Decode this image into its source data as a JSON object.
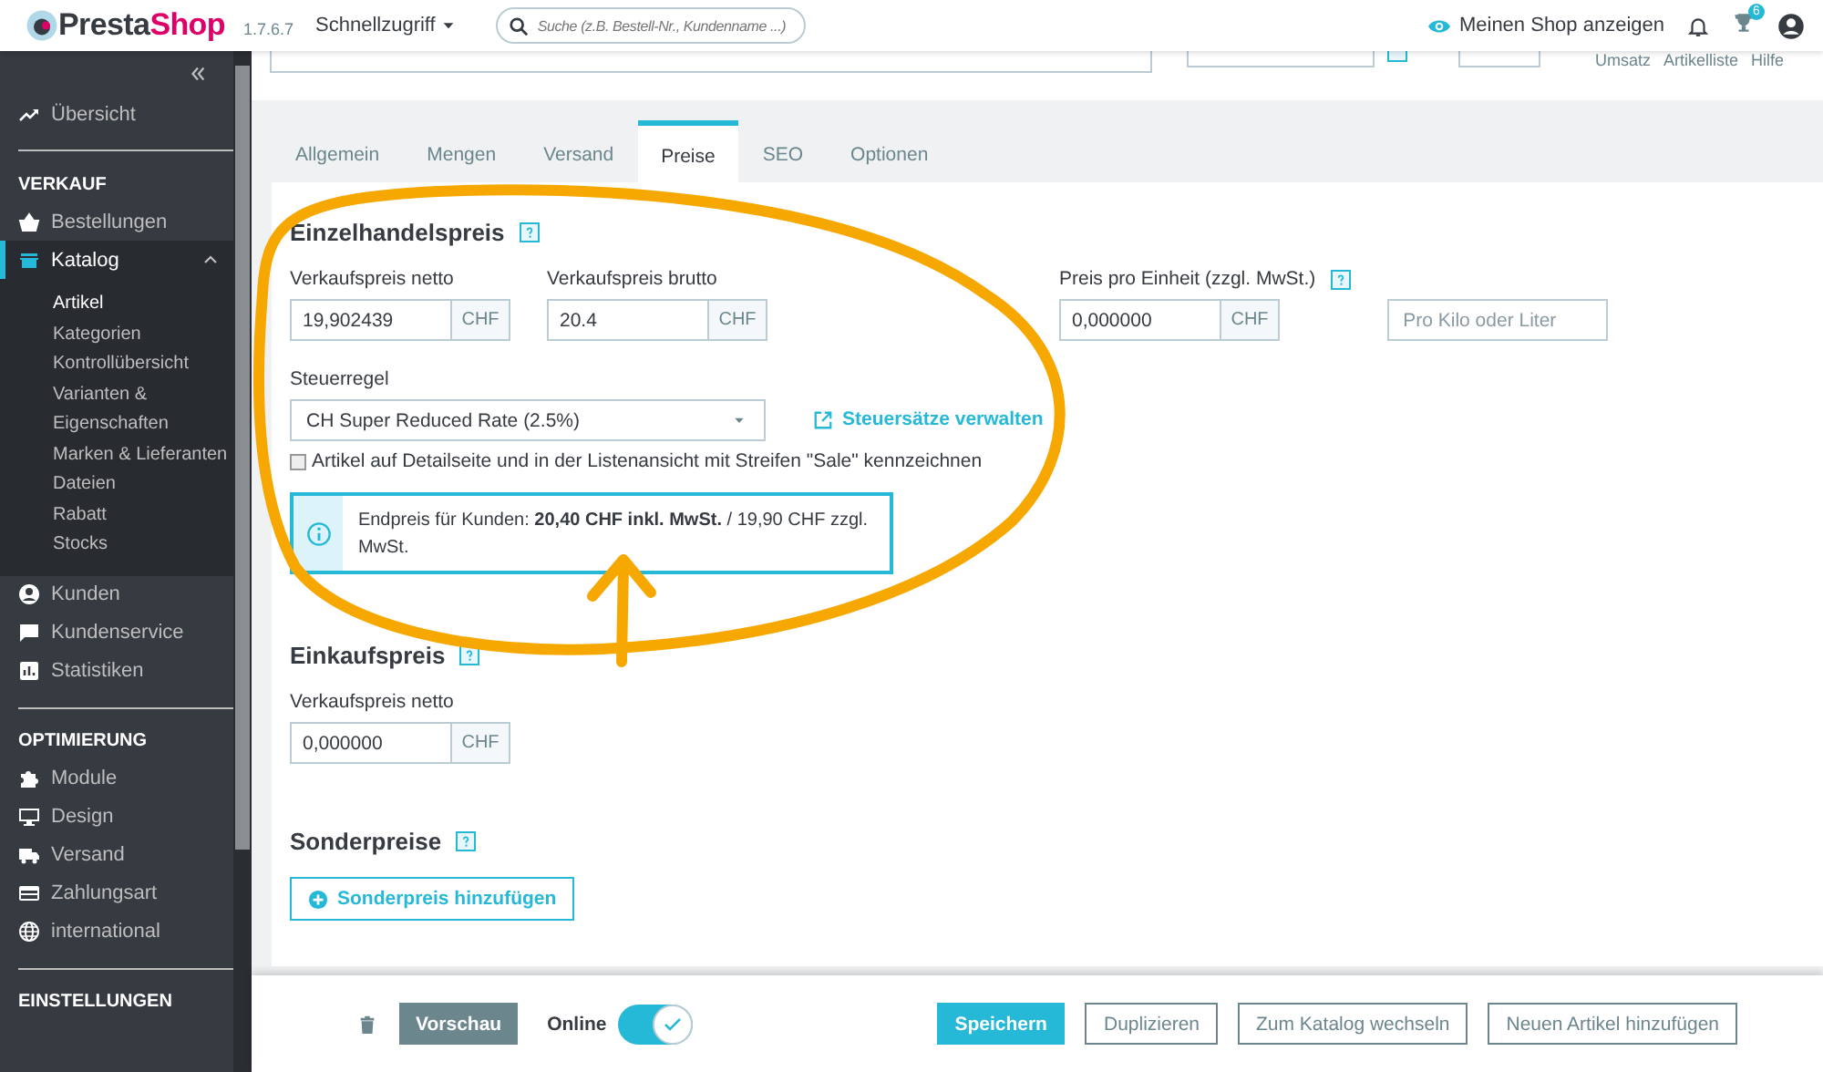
{
  "header": {
    "brand": [
      "Presta",
      "Shop"
    ],
    "version": "1.7.6.7",
    "quick_access": "Schnellzugriff",
    "search": {
      "placeholder": "Suche (z.B. Bestell-Nr., Kundenname ...)"
    },
    "show_shop": "Meinen Shop anzeigen",
    "trophy_badge": "6"
  },
  "product": {
    "links": [
      "Umsatz",
      "Artikelliste",
      "Hilfe"
    ]
  },
  "sidebar": {
    "items": [
      {
        "kind": "item",
        "label": "Übersicht",
        "selected": false
      },
      {
        "kind": "divider"
      },
      {
        "kind": "heading",
        "label": "VERKAUF"
      },
      {
        "kind": "item",
        "label": "Bestellungen",
        "selected": false
      },
      {
        "kind": "item",
        "label": "Katalog",
        "selected": true,
        "expanded": true,
        "children": [
          {
            "label": "Artikel",
            "selected": true
          },
          {
            "label": "Kategorien",
            "selected": false
          },
          {
            "label": "Kontrollübersicht",
            "selected": false
          },
          {
            "label": "Varianten & Eigenschaften",
            "selected": false
          },
          {
            "label": "Marken & Lieferanten",
            "selected": false
          },
          {
            "label": "Dateien",
            "selected": false
          },
          {
            "label": "Rabatt",
            "selected": false
          },
          {
            "label": "Stocks",
            "selected": false
          }
        ]
      },
      {
        "kind": "item",
        "label": "Kunden",
        "selected": false
      },
      {
        "kind": "item",
        "label": "Kundenservice",
        "selected": false
      },
      {
        "kind": "item",
        "label": "Statistiken",
        "selected": false
      },
      {
        "kind": "divider"
      },
      {
        "kind": "heading",
        "label": "OPTIMIERUNG"
      },
      {
        "kind": "item",
        "label": "Module",
        "selected": false
      },
      {
        "kind": "item",
        "label": "Design",
        "selected": false
      },
      {
        "kind": "item",
        "label": "Versand",
        "selected": false
      },
      {
        "kind": "item",
        "label": "Zahlungsart",
        "selected": false
      },
      {
        "kind": "item",
        "label": "international",
        "selected": false
      },
      {
        "kind": "divider"
      },
      {
        "kind": "heading",
        "label": "EINSTELLUNGEN"
      }
    ]
  },
  "tabs": [
    {
      "label": "Allgemein",
      "selected": false
    },
    {
      "label": "Mengen",
      "selected": false
    },
    {
      "label": "Versand",
      "selected": false
    },
    {
      "label": "Preise",
      "selected": true
    },
    {
      "label": "SEO",
      "selected": false
    },
    {
      "label": "Optionen",
      "selected": false
    }
  ],
  "retail": {
    "title": "Einzelhandelspreis",
    "net": {
      "label": "Verkaufspreis netto",
      "value": "19,902439",
      "unit": "CHF"
    },
    "gross": {
      "label": "Verkaufspreis brutto",
      "value": "20.4",
      "unit": "CHF"
    },
    "unit_price": {
      "label": "Preis pro Einheit (zzgl. MwSt.)",
      "value": "0,000000",
      "unit": "CHF",
      "per": {
        "placeholder": "Pro Kilo oder Liter"
      }
    },
    "tax_rule": {
      "label": "Steuerregel",
      "value": "CH Super Reduced Rate (2.5%)"
    },
    "tax_link": "Steuersätze verwalten",
    "sale_flag": {
      "label": "Artikel auf Detailseite und in der Listenansicht mit Streifen \"Sale\" kennzeichnen",
      "checked": false
    },
    "info": "Endpreis für Kunden: **20,40 CHF inkl. MwSt.** / 19,90 CHF zzgl. MwSt."
  },
  "cost": {
    "title": "Einkaufspreis",
    "label": "Verkaufspreis netto",
    "value": "0,000000",
    "unit": "CHF"
  },
  "specific": {
    "title": "Sonderpreise",
    "button": "Sonderpreis hinzufügen"
  },
  "footer": {
    "preview": "Vorschau",
    "online": {
      "label": "Online",
      "on": true
    },
    "buttons": [
      {
        "label": "Speichern",
        "kind": "primary"
      },
      {
        "label": "Duplizieren",
        "kind": "default"
      },
      {
        "label": "Zum Katalog wechseln",
        "kind": "default"
      },
      {
        "label": "Neuen Artikel hinzufügen",
        "kind": "default"
      }
    ]
  }
}
